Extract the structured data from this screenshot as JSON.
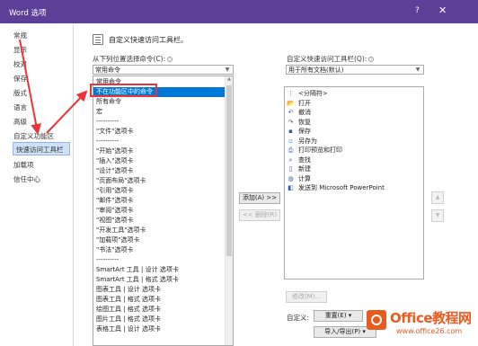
{
  "window": {
    "title": "Word 选项",
    "help_label": "?",
    "close_label": "✕"
  },
  "sidebar": {
    "items": [
      {
        "label": "常规"
      },
      {
        "label": "显示"
      },
      {
        "label": "校对"
      },
      {
        "label": "保存"
      },
      {
        "label": "版式"
      },
      {
        "label": "语言"
      },
      {
        "label": "高级"
      },
      {
        "label": "自定义功能区"
      },
      {
        "label": "快速访问工具栏",
        "selected": true
      },
      {
        "label": "加载项"
      },
      {
        "label": "信任中心"
      }
    ]
  },
  "main": {
    "header": "自定义快速访问工具栏。",
    "left_label": "从下列位置选择命令(C):",
    "left_combo_value": "常用命令",
    "left_list": [
      "常用命令",
      "不在功能区中的命令",
      "所有命令",
      "宏",
      "----------",
      "\"文件\"选项卡",
      "----------",
      "\"开始\"选项卡",
      "\"插入\"选项卡",
      "\"设计\"选项卡",
      "\"页面布局\"选项卡",
      "\"引用\"选项卡",
      "\"邮件\"选项卡",
      "\"审阅\"选项卡",
      "\"视图\"选项卡",
      "\"开发工具\"选项卡",
      "\"加载项\"选项卡",
      "\"书法\"选项卡",
      "----------",
      "SmartArt 工具 | 设计 选项卡",
      "SmartArt 工具 | 格式 选项卡",
      "图表工具 | 设计 选项卡",
      "图表工具 | 格式 选项卡",
      "绘图工具 | 格式 选项卡",
      "图片工具 | 格式 选项卡",
      "表格工具 | 设计 选项卡"
    ],
    "left_list_selected_index": 1,
    "add_button": "添加(A) >>",
    "remove_button": "<< 删除(R)",
    "right_label": "自定义快速访问工具栏(Q):",
    "right_combo_value": "用于所有文档(默认)",
    "qat_items": [
      {
        "icon": "separator-icon",
        "glyph": "⋮",
        "label": "<分隔符>"
      },
      {
        "icon": "open-folder-icon",
        "glyph": "📂",
        "label": "打开"
      },
      {
        "icon": "undo-icon",
        "glyph": "↶",
        "label": "撤消"
      },
      {
        "icon": "redo-icon",
        "glyph": "↷",
        "label": "恢复"
      },
      {
        "icon": "save-icon",
        "glyph": "▪",
        "label": "保存"
      },
      {
        "icon": "save-as-icon",
        "glyph": "▫",
        "label": "另存为"
      },
      {
        "icon": "print-preview-icon",
        "glyph": "⎙",
        "label": "打印预览和打印"
      },
      {
        "icon": "find-icon",
        "glyph": "⌕",
        "label": "查找"
      },
      {
        "icon": "new-document-icon",
        "glyph": "▯",
        "label": "新建"
      },
      {
        "icon": "calculate-icon",
        "glyph": "◍",
        "label": "计算"
      },
      {
        "icon": "send-powerpoint-icon",
        "glyph": "◧",
        "label": "发送到 Microsoft PowerPoint"
      }
    ],
    "modify_button": "修改(M)...",
    "customize_label": "自定义:",
    "reset_button": "重置(E) ▾",
    "import_export_button": "导入/导出(P) ▾"
  },
  "watermark": {
    "brand": "Office教程网",
    "url": "www.office26.com"
  },
  "colors": {
    "titlebar": "#5c3f97",
    "selection": "#0078d7",
    "callout": "#e8343a",
    "watermark": "#e85a1e"
  }
}
